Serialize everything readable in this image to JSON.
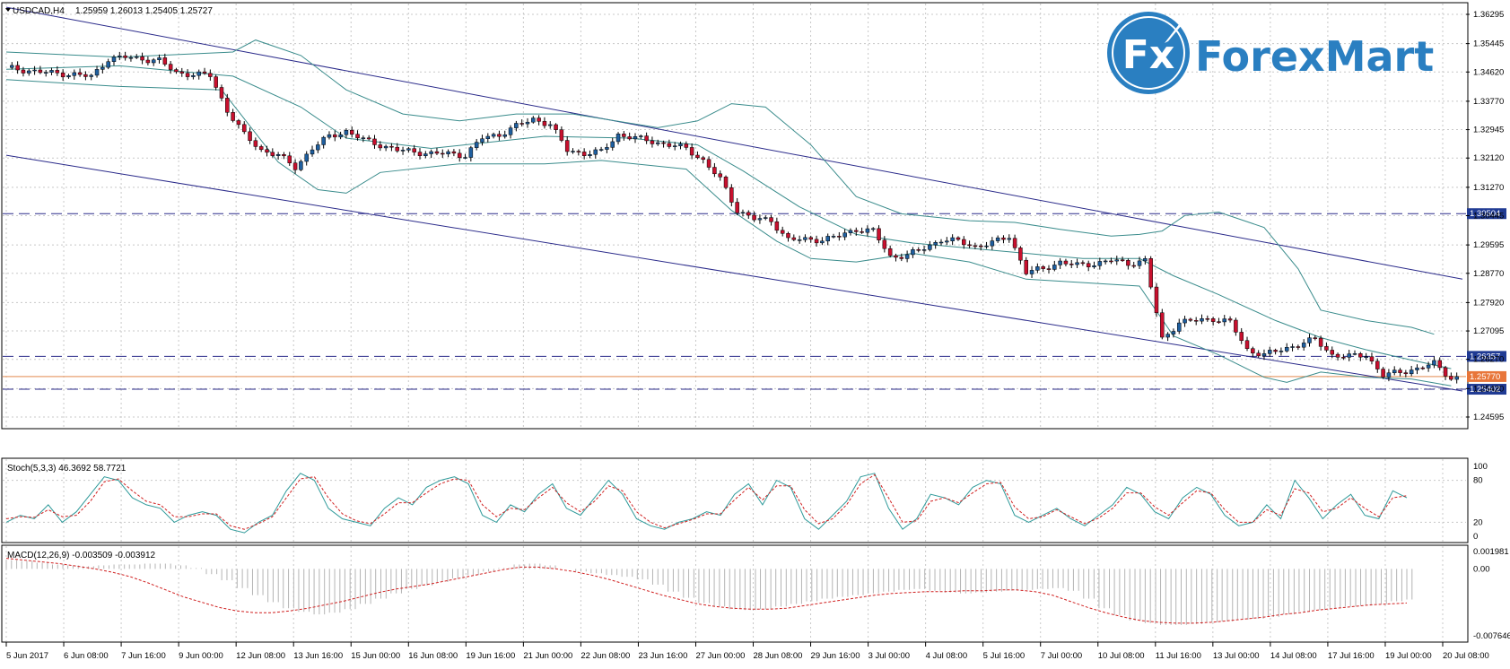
{
  "header": {
    "symbol": "USDCAD,H4",
    "ohlc": "1.25959 1.26013 1.25405 1.25727"
  },
  "logo": {
    "text": "ForexMart",
    "badge": "Fx",
    "color": "#2a7fc1"
  },
  "indicators": {
    "stoch_label": "Stoch(5,3,3) 46.3692 58.7721",
    "macd_label": "MACD(12,26,9) -0.003509 -0.003912"
  },
  "colors": {
    "bull": "#1f5f9f",
    "bear": "#c8102e",
    "bollinger": "#3a8c8c",
    "channel": "#2a2a8a",
    "level": "#2a2a8a",
    "price_line": "#e8a070",
    "tag_blue": "#1f3a93",
    "tag_orange": "#e8763a"
  },
  "chart_data": {
    "type": "candlestick",
    "price_axis": {
      "range": [
        1.24595,
        1.36295
      ],
      "ticks": [
        "1.36295",
        "1.35445",
        "1.34620",
        "1.33770",
        "1.32945",
        "1.32120",
        "1.31270",
        "1.30445",
        "1.29595",
        "1.28770",
        "1.27920",
        "1.27095",
        "1.26270",
        "1.25420",
        "1.24595"
      ]
    },
    "time_labels": [
      "5 Jun 2017",
      "6 Jun 08:00",
      "7 Jun 16:00",
      "9 Jun 00:00",
      "12 Jun 08:00",
      "13 Jun 16:00",
      "15 Jun 00:00",
      "16 Jun 08:00",
      "19 Jun 16:00",
      "21 Jun 00:00",
      "22 Jun 08:00",
      "23 Jun 16:00",
      "27 Jun 00:00",
      "28 Jun 08:00",
      "29 Jun 16:00",
      "3 Jul 00:00",
      "4 Jul 08:00",
      "5 Jul 16:00",
      "7 Jul 00:00",
      "10 Jul 08:00",
      "11 Jul 16:00",
      "13 Jul 00:00",
      "14 Jul 08:00",
      "17 Jul 16:00",
      "19 Jul 00:00",
      "20 Jul 08:00"
    ],
    "horizontal_levels": [
      {
        "price": 1.30504,
        "label": "1.30504",
        "tag": "blue"
      },
      {
        "price": 1.26357,
        "label": "1.26357",
        "tag": "blue"
      },
      {
        "price": 1.25402,
        "label": "1.25402",
        "tag": "blue"
      },
      {
        "price": 1.2577,
        "label": "1.25770",
        "tag": "orange"
      }
    ],
    "close_path": [
      [
        0,
        1.3475
      ],
      [
        3,
        1.3468
      ],
      [
        6,
        1.3462
      ],
      [
        9,
        1.3458
      ],
      [
        12,
        1.3455
      ],
      [
        15,
        1.3448
      ],
      [
        18,
        1.35
      ],
      [
        21,
        1.3505
      ],
      [
        24,
        1.35
      ],
      [
        27,
        1.3495
      ],
      [
        30,
        1.346
      ],
      [
        33,
        1.3455
      ],
      [
        36,
        1.3452
      ],
      [
        39,
        1.335
      ],
      [
        42,
        1.328
      ],
      [
        45,
        1.3235
      ],
      [
        48,
        1.322
      ],
      [
        51,
        1.3185
      ],
      [
        54,
        1.324
      ],
      [
        57,
        1.3275
      ],
      [
        60,
        1.329
      ],
      [
        63,
        1.3265
      ],
      [
        66,
        1.325
      ],
      [
        69,
        1.3235
      ],
      [
        72,
        1.323
      ],
      [
        75,
        1.3225
      ],
      [
        78,
        1.3225
      ],
      [
        81,
        1.322
      ],
      [
        84,
        1.327
      ],
      [
        87,
        1.328
      ],
      [
        90,
        1.3305
      ],
      [
        93,
        1.3325
      ],
      [
        96,
        1.331
      ],
      [
        99,
        1.3235
      ],
      [
        102,
        1.3225
      ],
      [
        105,
        1.323
      ],
      [
        108,
        1.328
      ],
      [
        111,
        1.327
      ],
      [
        114,
        1.326
      ],
      [
        117,
        1.325
      ],
      [
        120,
        1.324
      ],
      [
        123,
        1.3205
      ],
      [
        126,
        1.315
      ],
      [
        129,
        1.306
      ],
      [
        132,
        1.3035
      ],
      [
        135,
        1.303
      ],
      [
        138,
        1.2975
      ],
      [
        141,
        1.2975
      ],
      [
        144,
        1.2975
      ],
      [
        147,
        1.2985
      ],
      [
        150,
        1.3005
      ],
      [
        153,
        1.3
      ],
      [
        156,
        1.2925
      ],
      [
        159,
        1.293
      ],
      [
        162,
        1.295
      ],
      [
        165,
        1.2975
      ],
      [
        168,
        1.297
      ],
      [
        171,
        1.2955
      ],
      [
        174,
        1.2965
      ],
      [
        177,
        1.2985
      ],
      [
        180,
        1.288
      ],
      [
        183,
        1.289
      ],
      [
        186,
        1.291
      ],
      [
        189,
        1.29
      ],
      [
        192,
        1.2905
      ],
      [
        195,
        1.2915
      ],
      [
        198,
        1.2905
      ],
      [
        201,
        1.2915
      ],
      [
        204,
        1.2685
      ],
      [
        207,
        1.2735
      ],
      [
        210,
        1.274
      ],
      [
        213,
        1.2745
      ],
      [
        216,
        1.2735
      ],
      [
        219,
        1.2655
      ],
      [
        222,
        1.264
      ],
      [
        225,
        1.2655
      ],
      [
        228,
        1.267
      ],
      [
        231,
        1.2685
      ],
      [
        234,
        1.264
      ],
      [
        237,
        1.2635
      ],
      [
        240,
        1.264
      ],
      [
        243,
        1.258
      ],
      [
        246,
        1.259
      ],
      [
        249,
        1.26
      ],
      [
        252,
        1.2615
      ],
      [
        255,
        1.2573
      ]
    ],
    "bollinger_upper": [
      [
        0,
        1.352
      ],
      [
        20,
        1.3505
      ],
      [
        40,
        1.352
      ],
      [
        44,
        1.3555
      ],
      [
        52,
        1.351
      ],
      [
        60,
        1.341
      ],
      [
        70,
        1.334
      ],
      [
        80,
        1.332
      ],
      [
        90,
        1.334
      ],
      [
        100,
        1.334
      ],
      [
        115,
        1.33
      ],
      [
        122,
        1.332
      ],
      [
        128,
        1.337
      ],
      [
        134,
        1.336
      ],
      [
        142,
        1.325
      ],
      [
        150,
        1.31
      ],
      [
        158,
        1.305
      ],
      [
        170,
        1.303
      ],
      [
        178,
        1.3025
      ],
      [
        186,
        1.3005
      ],
      [
        195,
        1.2985
      ],
      [
        200,
        1.299
      ],
      [
        204,
        1.3
      ],
      [
        208,
        1.3045
      ],
      [
        214,
        1.3055
      ],
      [
        222,
        1.301
      ],
      [
        228,
        1.289
      ],
      [
        232,
        1.277
      ],
      [
        240,
        1.274
      ],
      [
        248,
        1.272
      ],
      [
        252,
        1.27
      ]
    ],
    "bollinger_middle": [
      [
        0,
        1.347
      ],
      [
        20,
        1.348
      ],
      [
        40,
        1.345
      ],
      [
        52,
        1.336
      ],
      [
        60,
        1.327
      ],
      [
        75,
        1.324
      ],
      [
        95,
        1.3275
      ],
      [
        110,
        1.327
      ],
      [
        122,
        1.325
      ],
      [
        130,
        1.3175
      ],
      [
        140,
        1.307
      ],
      [
        150,
        1.299
      ],
      [
        160,
        1.2965
      ],
      [
        170,
        1.295
      ],
      [
        180,
        1.2935
      ],
      [
        190,
        1.292
      ],
      [
        200,
        1.292
      ],
      [
        206,
        1.287
      ],
      [
        214,
        1.2815
      ],
      [
        224,
        1.274
      ],
      [
        232,
        1.269
      ],
      [
        240,
        1.2655
      ],
      [
        248,
        1.2625
      ],
      [
        255,
        1.26
      ]
    ],
    "bollinger_lower": [
      [
        0,
        1.344
      ],
      [
        20,
        1.342
      ],
      [
        38,
        1.341
      ],
      [
        48,
        1.32
      ],
      [
        55,
        1.312
      ],
      [
        60,
        1.311
      ],
      [
        66,
        1.317
      ],
      [
        80,
        1.3195
      ],
      [
        95,
        1.3195
      ],
      [
        105,
        1.3205
      ],
      [
        120,
        1.318
      ],
      [
        128,
        1.306
      ],
      [
        136,
        1.297
      ],
      [
        142,
        1.292
      ],
      [
        150,
        1.291
      ],
      [
        160,
        1.2935
      ],
      [
        170,
        1.291
      ],
      [
        180,
        1.286
      ],
      [
        190,
        1.285
      ],
      [
        200,
        1.284
      ],
      [
        206,
        1.2695
      ],
      [
        214,
        1.264
      ],
      [
        222,
        1.2575
      ],
      [
        226,
        1.256
      ],
      [
        232,
        1.259
      ],
      [
        240,
        1.2575
      ],
      [
        248,
        1.257
      ],
      [
        255,
        1.255
      ]
    ],
    "channel_upper": {
      "from": [
        0,
        1.365
      ],
      "to": [
        257,
        1.286
      ]
    },
    "channel_lower": {
      "from": [
        0,
        1.322
      ],
      "to": [
        257,
        1.2535
      ]
    },
    "stochastic": {
      "range": [
        0,
        100
      ],
      "ticks": [
        "100",
        "80",
        "20",
        "0"
      ],
      "main": [
        20,
        30,
        25,
        45,
        20,
        35,
        60,
        85,
        80,
        55,
        45,
        40,
        20,
        30,
        35,
        30,
        10,
        5,
        20,
        30,
        65,
        90,
        80,
        40,
        25,
        20,
        15,
        40,
        55,
        45,
        70,
        80,
        85,
        75,
        30,
        20,
        45,
        35,
        60,
        75,
        40,
        30,
        55,
        80,
        60,
        25,
        15,
        10,
        20,
        25,
        35,
        30,
        60,
        75,
        45,
        80,
        70,
        25,
        10,
        30,
        50,
        85,
        90,
        40,
        10,
        25,
        60,
        55,
        45,
        70,
        80,
        75,
        30,
        20,
        30,
        40,
        25,
        15,
        30,
        45,
        70,
        60,
        35,
        25,
        55,
        70,
        60,
        30,
        15,
        20,
        45,
        25,
        80,
        55,
        25,
        45,
        60,
        30,
        25,
        65,
        55
      ],
      "signal": [
        25,
        28,
        27,
        38,
        28,
        30,
        50,
        78,
        82,
        65,
        50,
        45,
        28,
        28,
        32,
        32,
        15,
        10,
        18,
        28,
        55,
        82,
        85,
        55,
        32,
        22,
        18,
        32,
        48,
        48,
        62,
        75,
        82,
        80,
        45,
        28,
        40,
        38,
        55,
        70,
        48,
        35,
        50,
        72,
        65,
        35,
        20,
        12,
        18,
        24,
        32,
        32,
        52,
        70,
        52,
        72,
        72,
        38,
        18,
        25,
        45,
        75,
        88,
        55,
        20,
        22,
        50,
        55,
        48,
        62,
        75,
        77,
        42,
        25,
        28,
        38,
        28,
        18,
        26,
        40,
        62,
        62,
        42,
        30,
        48,
        65,
        62,
        38,
        20,
        20,
        38,
        30,
        68,
        62,
        35,
        40,
        55,
        40,
        28,
        55,
        58
      ]
    },
    "macd": {
      "range": [
        -0.007646,
        0.001981
      ],
      "ticks": [
        "0.001981",
        "0.00",
        "-0.007646"
      ],
      "histogram": [
        0.001,
        0.0009,
        0.0007,
        0.0005,
        0.0004,
        0.0003,
        0.0004,
        0.0005,
        0.0005,
        0.0006,
        0.0006,
        0.0004,
        0.0001,
        -0.0006,
        -0.0013,
        -0.0022,
        -0.003,
        -0.0038,
        -0.0045,
        -0.0049,
        -0.0052,
        -0.005,
        -0.0046,
        -0.004,
        -0.0034,
        -0.0028,
        -0.0023,
        -0.0019,
        -0.0015,
        -0.0011,
        -0.0007,
        -0.0003,
        0.0001,
        0.0005,
        0.0006,
        0.0004,
        0.0,
        -0.0003,
        -0.0005,
        -0.0007,
        -0.0009,
        -0.0012,
        -0.0018,
        -0.0026,
        -0.0033,
        -0.0039,
        -0.0043,
        -0.0046,
        -0.0047,
        -0.0046,
        -0.0043,
        -0.004,
        -0.0037,
        -0.0034,
        -0.0032,
        -0.003,
        -0.0028,
        -0.0026,
        -0.0024,
        -0.0023,
        -0.0025,
        -0.0027,
        -0.0028,
        -0.0027,
        -0.0026,
        -0.0025,
        -0.0024,
        -0.0023,
        -0.0022,
        -0.0025,
        -0.0034,
        -0.0045,
        -0.0053,
        -0.0059,
        -0.0062,
        -0.0064,
        -0.0064,
        -0.0063,
        -0.0061,
        -0.006,
        -0.0058,
        -0.0057,
        -0.0055,
        -0.0052,
        -0.0049,
        -0.0047,
        -0.0045,
        -0.0043,
        -0.0042,
        -0.004,
        -0.0037,
        -0.0035
      ],
      "signal": [
        0.0012,
        0.001,
        0.0008,
        0.0006,
        0.0003,
        0.0,
        -0.0004,
        -0.0009,
        -0.0016,
        -0.0024,
        -0.0032,
        -0.0038,
        -0.0044,
        -0.0048,
        -0.005,
        -0.005,
        -0.0048,
        -0.0045,
        -0.0041,
        -0.0037,
        -0.0032,
        -0.0027,
        -0.0023,
        -0.002,
        -0.0017,
        -0.0013,
        -0.0009,
        -0.0005,
        -0.0001,
        0.0002,
        0.0002,
        0.0,
        -0.0003,
        -0.0007,
        -0.0012,
        -0.0018,
        -0.0024,
        -0.003,
        -0.0035,
        -0.004,
        -0.0043,
        -0.0045,
        -0.0046,
        -0.0046,
        -0.0045,
        -0.0042,
        -0.0039,
        -0.0036,
        -0.0033,
        -0.003,
        -0.0028,
        -0.0027,
        -0.0026,
        -0.0026,
        -0.0025,
        -0.0025,
        -0.0024,
        -0.0024,
        -0.0026,
        -0.003,
        -0.0037,
        -0.0044,
        -0.005,
        -0.0055,
        -0.0059,
        -0.0061,
        -0.0062,
        -0.0062,
        -0.0061,
        -0.0059,
        -0.0057,
        -0.0055,
        -0.0052,
        -0.005,
        -0.0047,
        -0.0045,
        -0.0043,
        -0.0041,
        -0.004,
        -0.0039
      ]
    }
  }
}
